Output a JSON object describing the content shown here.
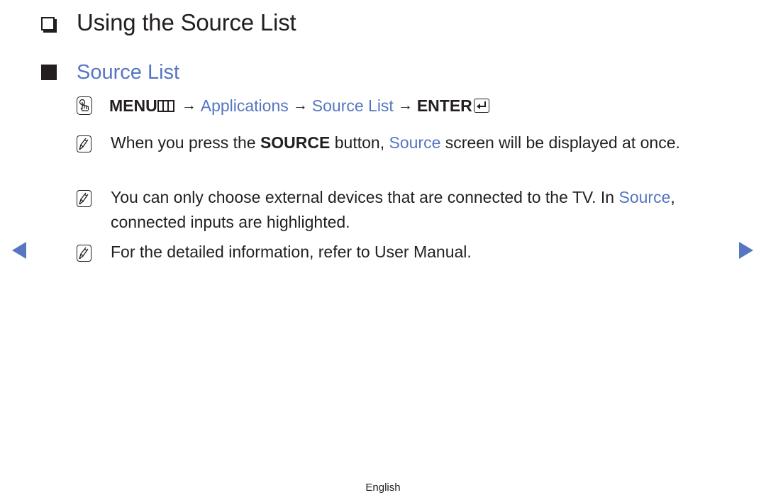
{
  "page": {
    "title": "Using the Source List",
    "section_title": "Source List",
    "accent_color": "#5676c2",
    "icons": {
      "title_bullet": "checkbox-icon",
      "section_bullet": "filled-square-icon",
      "path_prefix": "touch-hand-icon",
      "menu_key": "menu-icon",
      "enter_key": "enter-icon",
      "note": "note-pencil-icon",
      "prev": "triangle-left-icon",
      "next": "triangle-right-icon"
    }
  },
  "menu_path": {
    "menu": "MENU",
    "arrow": "→",
    "applications": "Applications",
    "source_list": "Source List",
    "enter": "ENTER"
  },
  "notes": [
    {
      "part1": "When you press the ",
      "bold": "SOURCE",
      "part2": " button, ",
      "link": "Source",
      "part3": " screen will be displayed at once."
    },
    {
      "part1": "You can only choose external devices that are connected to the TV. In ",
      "link": "Source",
      "part2": ", connected inputs are highlighted."
    },
    {
      "text": "For the detailed information, refer to User Manual."
    }
  ],
  "footer": {
    "language": "English"
  }
}
